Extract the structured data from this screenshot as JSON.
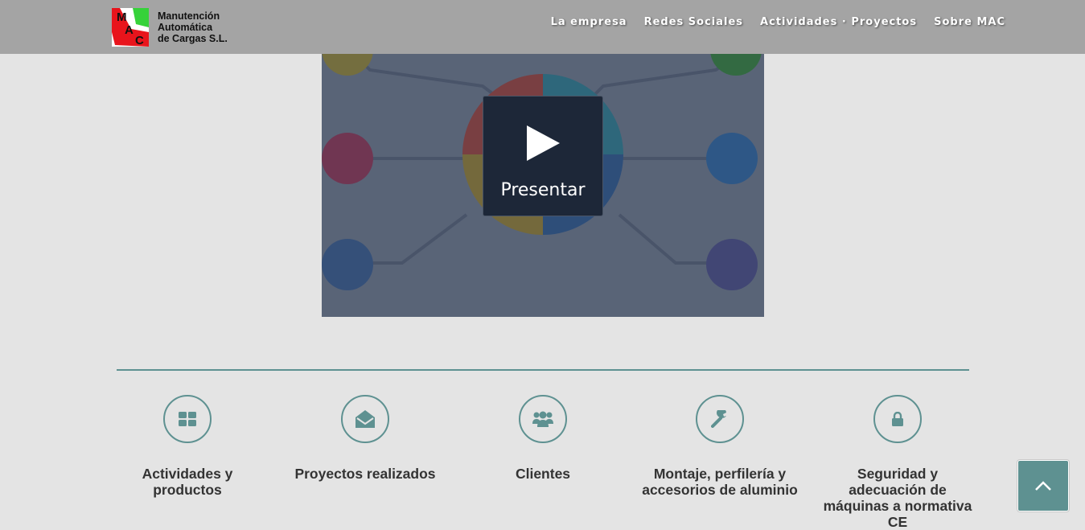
{
  "brand": {
    "logo_letters": [
      "M",
      "A",
      "C"
    ],
    "name_lines": [
      "Manutención",
      "Automática",
      "de Cargas S.L."
    ]
  },
  "nav": {
    "items": [
      {
        "label": "La empresa"
      },
      {
        "label": "Redes Sociales"
      },
      {
        "label": "Actividades · Proyectos"
      },
      {
        "label": "Sobre MAC"
      }
    ]
  },
  "video": {
    "play_label": "Presentar"
  },
  "features": [
    {
      "icon": "grid-icon",
      "title": "Actividades y productos"
    },
    {
      "icon": "open-envelope-icon",
      "title": "Proyectos realizados"
    },
    {
      "icon": "users-icon",
      "title": "Clientes"
    },
    {
      "icon": "wrench-icon",
      "title": "Montaje, perfilería y accesorios de aluminio"
    },
    {
      "icon": "lock-icon",
      "title": "Seguridad y adecuación de máquinas a normativa CE"
    }
  ],
  "colors": {
    "accent": "#5e9191",
    "header": "#a4a4a4",
    "background": "#e4e4e4",
    "text": "#333333"
  },
  "back_to_top": {
    "icon": "chevron-up-icon"
  }
}
